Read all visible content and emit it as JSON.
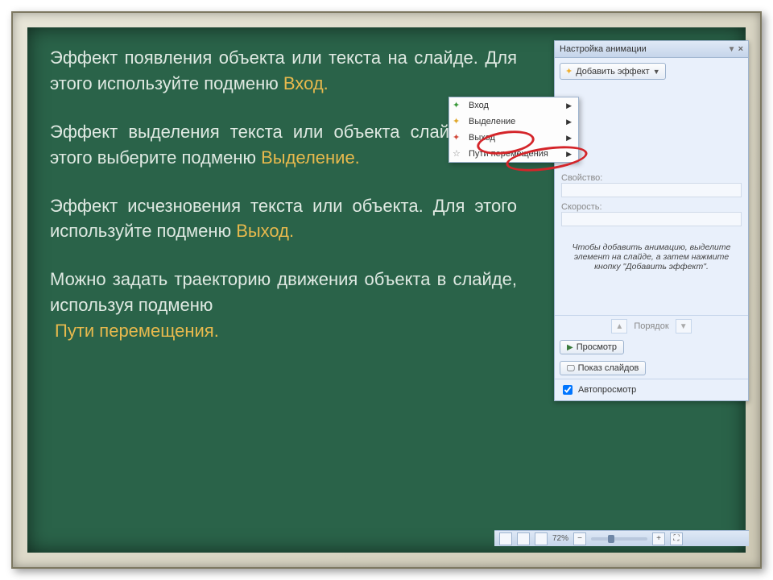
{
  "slide": {
    "p1a": "Эффект появления объекта или текста на слайде. Для этого используйте подменю ",
    "p1h": "Вход.",
    "p2a": "Эффект выделения текста или объекта слайда. Для этого выберите подменю ",
    "p2h": "Выделение.",
    "p3a": "Эффект исчезновения текста или объекта. Для этого используйте подменю ",
    "p3h": "Выход.",
    "p4a": "Можно задать траекторию движения объекта в слайде, используя подменю ",
    "p4h": "Пути перемещения."
  },
  "panel": {
    "title": "Настройка анимации",
    "add_effect": "Добавить эффект",
    "menu": {
      "entry": "Вход",
      "emphasis": "Выделение",
      "exit": "Выход",
      "motion": "Пути перемещения"
    },
    "prop_label": "Свойство:",
    "speed_label": "Скорость:",
    "hint": "Чтобы добавить анимацию, выделите элемент на слайде, а затем нажмите кнопку \"Добавить эффект\".",
    "order": "Порядок",
    "preview": "Просмотр",
    "slideshow": "Показ слайдов",
    "autopreview": "Автопросмотр"
  },
  "status": {
    "zoom": "72%"
  }
}
